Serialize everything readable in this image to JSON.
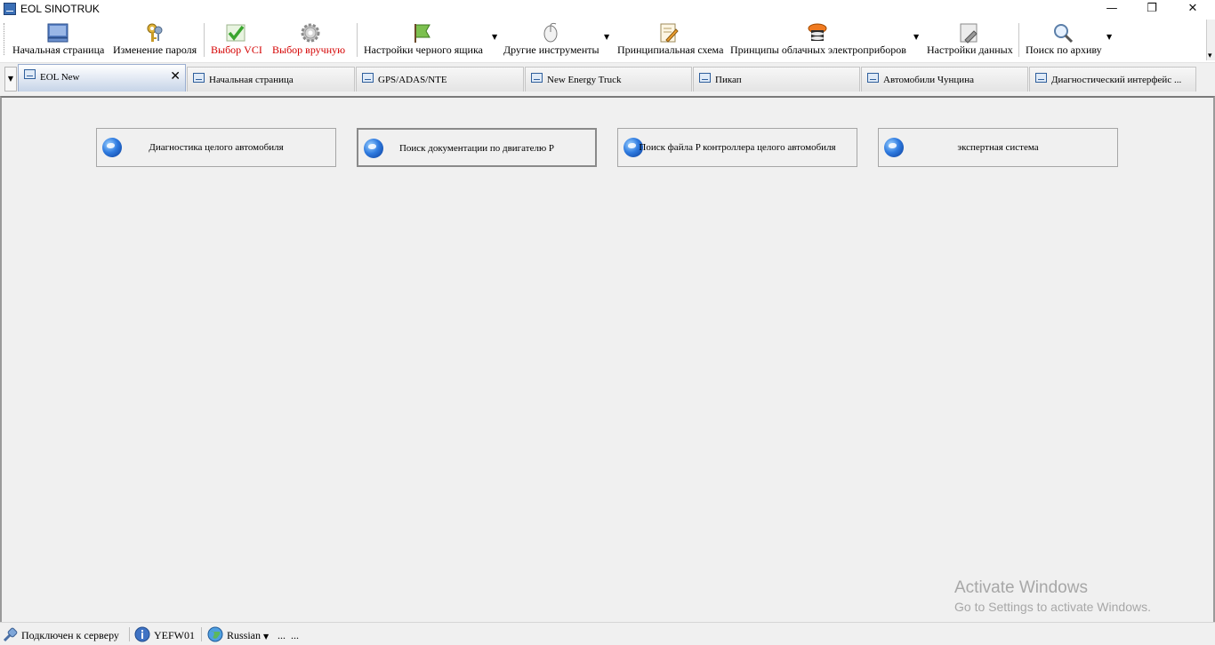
{
  "window": {
    "title": "EOL SINOTRUK",
    "minimize_icon": "minimize-icon",
    "restore_icon": "restore-icon",
    "close_icon": "close-icon"
  },
  "toolbar": {
    "home": "Начальная страница",
    "change_password": "Изменение пароля",
    "select_vci": "Выбор VCI",
    "manual_select": "Выбор вручную",
    "blackbox_settings": "Настройки черного ящика",
    "other_tools": "Другие инструменты",
    "schematic": "Принципиальная схема",
    "cloud_principles": "Принципы облачных электроприборов",
    "data_settings": "Настройки данных",
    "archive_search": "Поиск по архиву"
  },
  "tabs": [
    {
      "label": "EOL New"
    },
    {
      "label": "Начальная страница"
    },
    {
      "label": "GPS/ADAS/NTE"
    },
    {
      "label": "New Energy Truck"
    },
    {
      "label": "Пикап"
    },
    {
      "label": "Автомобили Чунцина"
    },
    {
      "label": "Диагностический интерфейс ..."
    }
  ],
  "modules": [
    {
      "label": "Диагностика целого автомобиля"
    },
    {
      "label": "Поиск документации по двигателю P"
    },
    {
      "label": "Поиск файла P контроллера целого автомобиля"
    },
    {
      "label": "экспертная система"
    }
  ],
  "watermark": {
    "line1": "Activate Windows",
    "line2": "Go to Settings to activate Windows."
  },
  "status": {
    "connection": "Подключен к серверу",
    "user": "YEFW01",
    "language": "Russian",
    "extra1": "...",
    "extra2": "..."
  },
  "colors": {
    "accent_red": "#d40000",
    "tab_active": "#c6d4e8",
    "content_bg": "#f0f0f0"
  }
}
